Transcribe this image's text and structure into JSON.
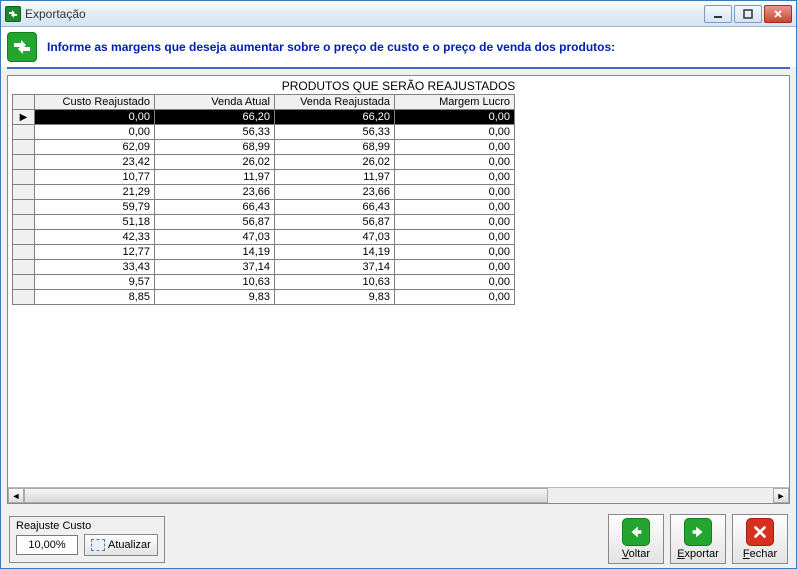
{
  "window_title": "Exportação",
  "header_text": "Informe as margens que deseja aumentar sobre o preço de custo e o preço de venda dos produtos:",
  "grid_title": "PRODUTOS QUE SERÃO REAJUSTADOS",
  "columns": [
    "Custo Reajustado",
    "Venda Atual",
    "Venda Reajustada",
    "Margem Lucro"
  ],
  "rows": [
    [
      "0,00",
      "66,20",
      "66,20",
      "0,00"
    ],
    [
      "0,00",
      "56,33",
      "56,33",
      "0,00"
    ],
    [
      "62,09",
      "68,99",
      "68,99",
      "0,00"
    ],
    [
      "23,42",
      "26,02",
      "26,02",
      "0,00"
    ],
    [
      "10,77",
      "11,97",
      "11,97",
      "0,00"
    ],
    [
      "21,29",
      "23,66",
      "23,66",
      "0,00"
    ],
    [
      "59,79",
      "66,43",
      "66,43",
      "0,00"
    ],
    [
      "51,18",
      "56,87",
      "56,87",
      "0,00"
    ],
    [
      "42,33",
      "47,03",
      "47,03",
      "0,00"
    ],
    [
      "12,77",
      "14,19",
      "14,19",
      "0,00"
    ],
    [
      "33,43",
      "37,14",
      "37,14",
      "0,00"
    ],
    [
      "9,57",
      "10,63",
      "10,63",
      "0,00"
    ],
    [
      "8,85",
      "9,83",
      "9,83",
      "0,00"
    ]
  ],
  "selected_row": 0,
  "reajuste": {
    "label": "Reajuste Custo",
    "value": "10,00%",
    "update_label": "Atualizar"
  },
  "buttons": {
    "back": "Voltar",
    "export": "Exportar",
    "close": "Fechar"
  }
}
